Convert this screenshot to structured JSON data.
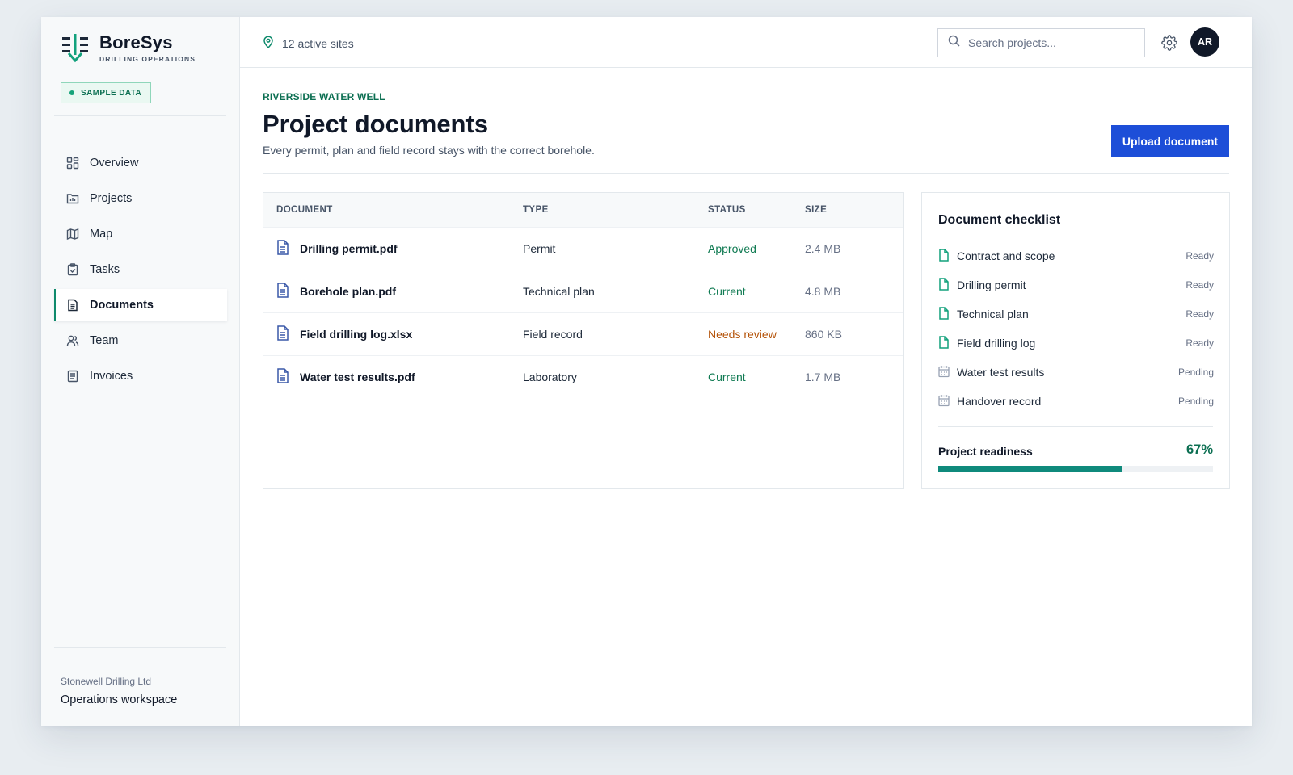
{
  "brand": {
    "name": "BoreSys",
    "subtitle": "DRILLING OPERATIONS"
  },
  "sample_badge": "SAMPLE DATA",
  "sidebar": {
    "items": [
      {
        "label": "Overview",
        "icon": "grid-icon",
        "active": false
      },
      {
        "label": "Projects",
        "icon": "folder-chart-icon",
        "active": false
      },
      {
        "label": "Map",
        "icon": "map-icon",
        "active": false
      },
      {
        "label": "Tasks",
        "icon": "clipboard-check-icon",
        "active": false
      },
      {
        "label": "Documents",
        "icon": "document-icon",
        "active": true
      },
      {
        "label": "Team",
        "icon": "users-icon",
        "active": false
      },
      {
        "label": "Invoices",
        "icon": "receipt-icon",
        "active": false
      }
    ],
    "footer": {
      "company": "Stonewell Drilling Ltd",
      "workspace": "Operations workspace"
    }
  },
  "topbar": {
    "sites": "12 active sites",
    "search_placeholder": "Search projects...",
    "avatar_initials": "AR"
  },
  "page": {
    "eyebrow": "RIVERSIDE WATER WELL",
    "title": "Project documents",
    "subtitle": "Every permit, plan and field record stays with the correct borehole.",
    "upload_label": "Upload document"
  },
  "table": {
    "headers": [
      "DOCUMENT",
      "TYPE",
      "STATUS",
      "SIZE"
    ],
    "rows": [
      {
        "name": "Drilling permit.pdf",
        "type": "Permit",
        "status": "Approved",
        "size": "2.4 MB"
      },
      {
        "name": "Borehole plan.pdf",
        "type": "Technical plan",
        "status": "Current",
        "size": "4.8 MB"
      },
      {
        "name": "Field drilling log.xlsx",
        "type": "Field record",
        "status": "Needs review",
        "size": "860 KB"
      },
      {
        "name": "Water test results.pdf",
        "type": "Laboratory",
        "status": "Current",
        "size": "1.7 MB"
      }
    ]
  },
  "checklist": {
    "title": "Document checklist",
    "items": [
      {
        "label": "Contract and scope",
        "state": "Ready"
      },
      {
        "label": "Drilling permit",
        "state": "Ready"
      },
      {
        "label": "Technical plan",
        "state": "Ready"
      },
      {
        "label": "Field drilling log",
        "state": "Ready"
      },
      {
        "label": "Water test results",
        "state": "Pending"
      },
      {
        "label": "Handover record",
        "state": "Pending"
      }
    ],
    "readiness_label": "Project readiness",
    "readiness_value": "67%",
    "readiness_fraction": 0.67
  },
  "colors": {
    "accent": "#0f8a6c",
    "primary_button": "#1d4ed8",
    "status_ok": "#0f7a52",
    "status_warn": "#b45309",
    "document_icon": "#3a58a8"
  }
}
